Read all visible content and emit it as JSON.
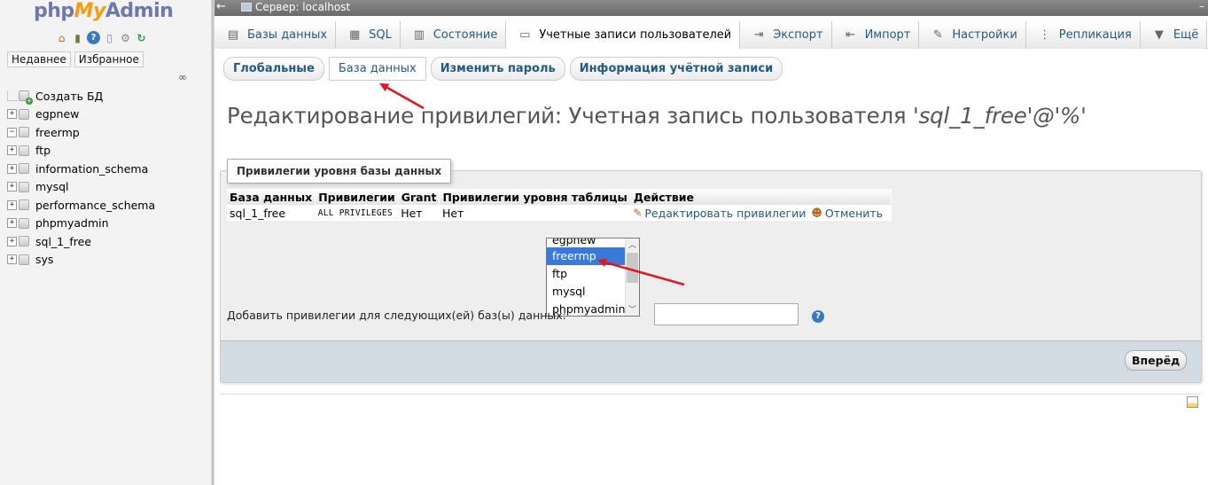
{
  "logo": {
    "part1": "php",
    "part2": "My",
    "part3": "Admin"
  },
  "nav": {
    "tabs": [
      "Недавнее",
      "Избранное"
    ],
    "new_db": "Создать БД",
    "databases": [
      "egpnew",
      "freermp",
      "ftp",
      "information_schema",
      "mysql",
      "performance_schema",
      "phpmyadmin",
      "sql_1_free",
      "sys"
    ],
    "icons": [
      "home-icon",
      "exit-icon",
      "help-icon",
      "docs-icon",
      "settings-icon",
      "reload-icon"
    ]
  },
  "topbar": {
    "server": "Сервер: localhost"
  },
  "menu": {
    "tabs": [
      {
        "label": "Базы данных",
        "icon": "database-icon"
      },
      {
        "label": "SQL",
        "icon": "sql-icon"
      },
      {
        "label": "Состояние",
        "icon": "status-icon"
      },
      {
        "label": "Учетные записи пользователей",
        "icon": "users-icon"
      },
      {
        "label": "Экспорт",
        "icon": "export-icon"
      },
      {
        "label": "Импорт",
        "icon": "import-icon"
      },
      {
        "label": "Настройки",
        "icon": "settings-icon"
      },
      {
        "label": "Репликация",
        "icon": "replication-icon"
      },
      {
        "label": "Ещё",
        "icon": "more-icon"
      }
    ]
  },
  "subtabs": [
    "Глобальные",
    "База данных",
    "Изменить пароль",
    "Информация учётной записи"
  ],
  "heading": {
    "text": "Редактирование привилегий: Учетная запись пользователя ",
    "account": "'sql_1_free'@'%'"
  },
  "fieldset": {
    "legend": "Привилегии уровня базы данных",
    "columns": [
      "База данных",
      "Привилегии",
      "Grant",
      "Привилегии уровня таблицы",
      "Действие"
    ],
    "row": {
      "db": "sql_1_free",
      "privileges": "ALL PRIVILEGES",
      "grant": "Нет",
      "table_privileges": "Нет"
    },
    "actions": {
      "edit": "Редактировать привилегии",
      "revoke": "Отменить"
    },
    "db_options": [
      "egpnew",
      "freermp",
      "ftp",
      "mysql",
      "phpmyadmin"
    ],
    "selected_db": "freermp",
    "add_label": "Добавить привилегии для следующих(ей) баз(ы) данных:",
    "db_text_value": "",
    "go": "Вперёд"
  },
  "colors": {
    "link": "#235a81",
    "selected": "#3879d9",
    "annotation_arrow": "#e8141c"
  }
}
